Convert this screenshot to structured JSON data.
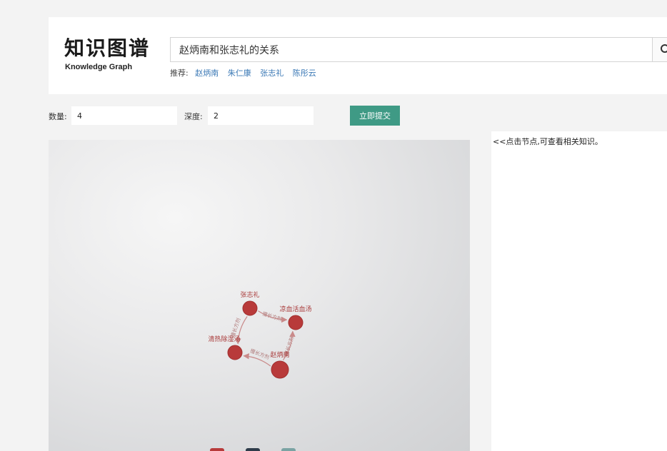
{
  "header": {
    "title": "知识图谱",
    "subtitle": "Knowledge Graph"
  },
  "search": {
    "value": "赵炳南和张志礼的关系",
    "icon": "search-icon"
  },
  "recommend": {
    "label": "推荐:",
    "items": [
      "赵炳南",
      "朱仁康",
      "张志礼",
      "陈彤云"
    ]
  },
  "form": {
    "count_label": "数量:",
    "count_value": "4",
    "depth_label": "深度:",
    "depth_value": "2",
    "submit_label": "立即提交"
  },
  "graph": {
    "node_color": "#b83a3a",
    "edge_color": "#c98a8a",
    "nodes": [
      {
        "id": "n1",
        "label": "张志礼"
      },
      {
        "id": "n2",
        "label": "凉血活血汤"
      },
      {
        "id": "n3",
        "label": "清热除湿汤"
      },
      {
        "id": "n4",
        "label": "赵炳南"
      }
    ],
    "edges": [
      {
        "from": "n4",
        "to": "n2",
        "label": "擅长方剂"
      },
      {
        "from": "n4",
        "to": "n3",
        "label": "擅长方剂"
      },
      {
        "from": "n1",
        "to": "n2",
        "label": "擅长方剂"
      },
      {
        "from": "n1",
        "to": "n3",
        "label": "擅长方剂"
      }
    ],
    "legend_colors": [
      "#b83a3a",
      "#2e3b4a",
      "#7aa3a3"
    ]
  },
  "info": {
    "hint": "<<点击节点,可查看相关知识。"
  }
}
